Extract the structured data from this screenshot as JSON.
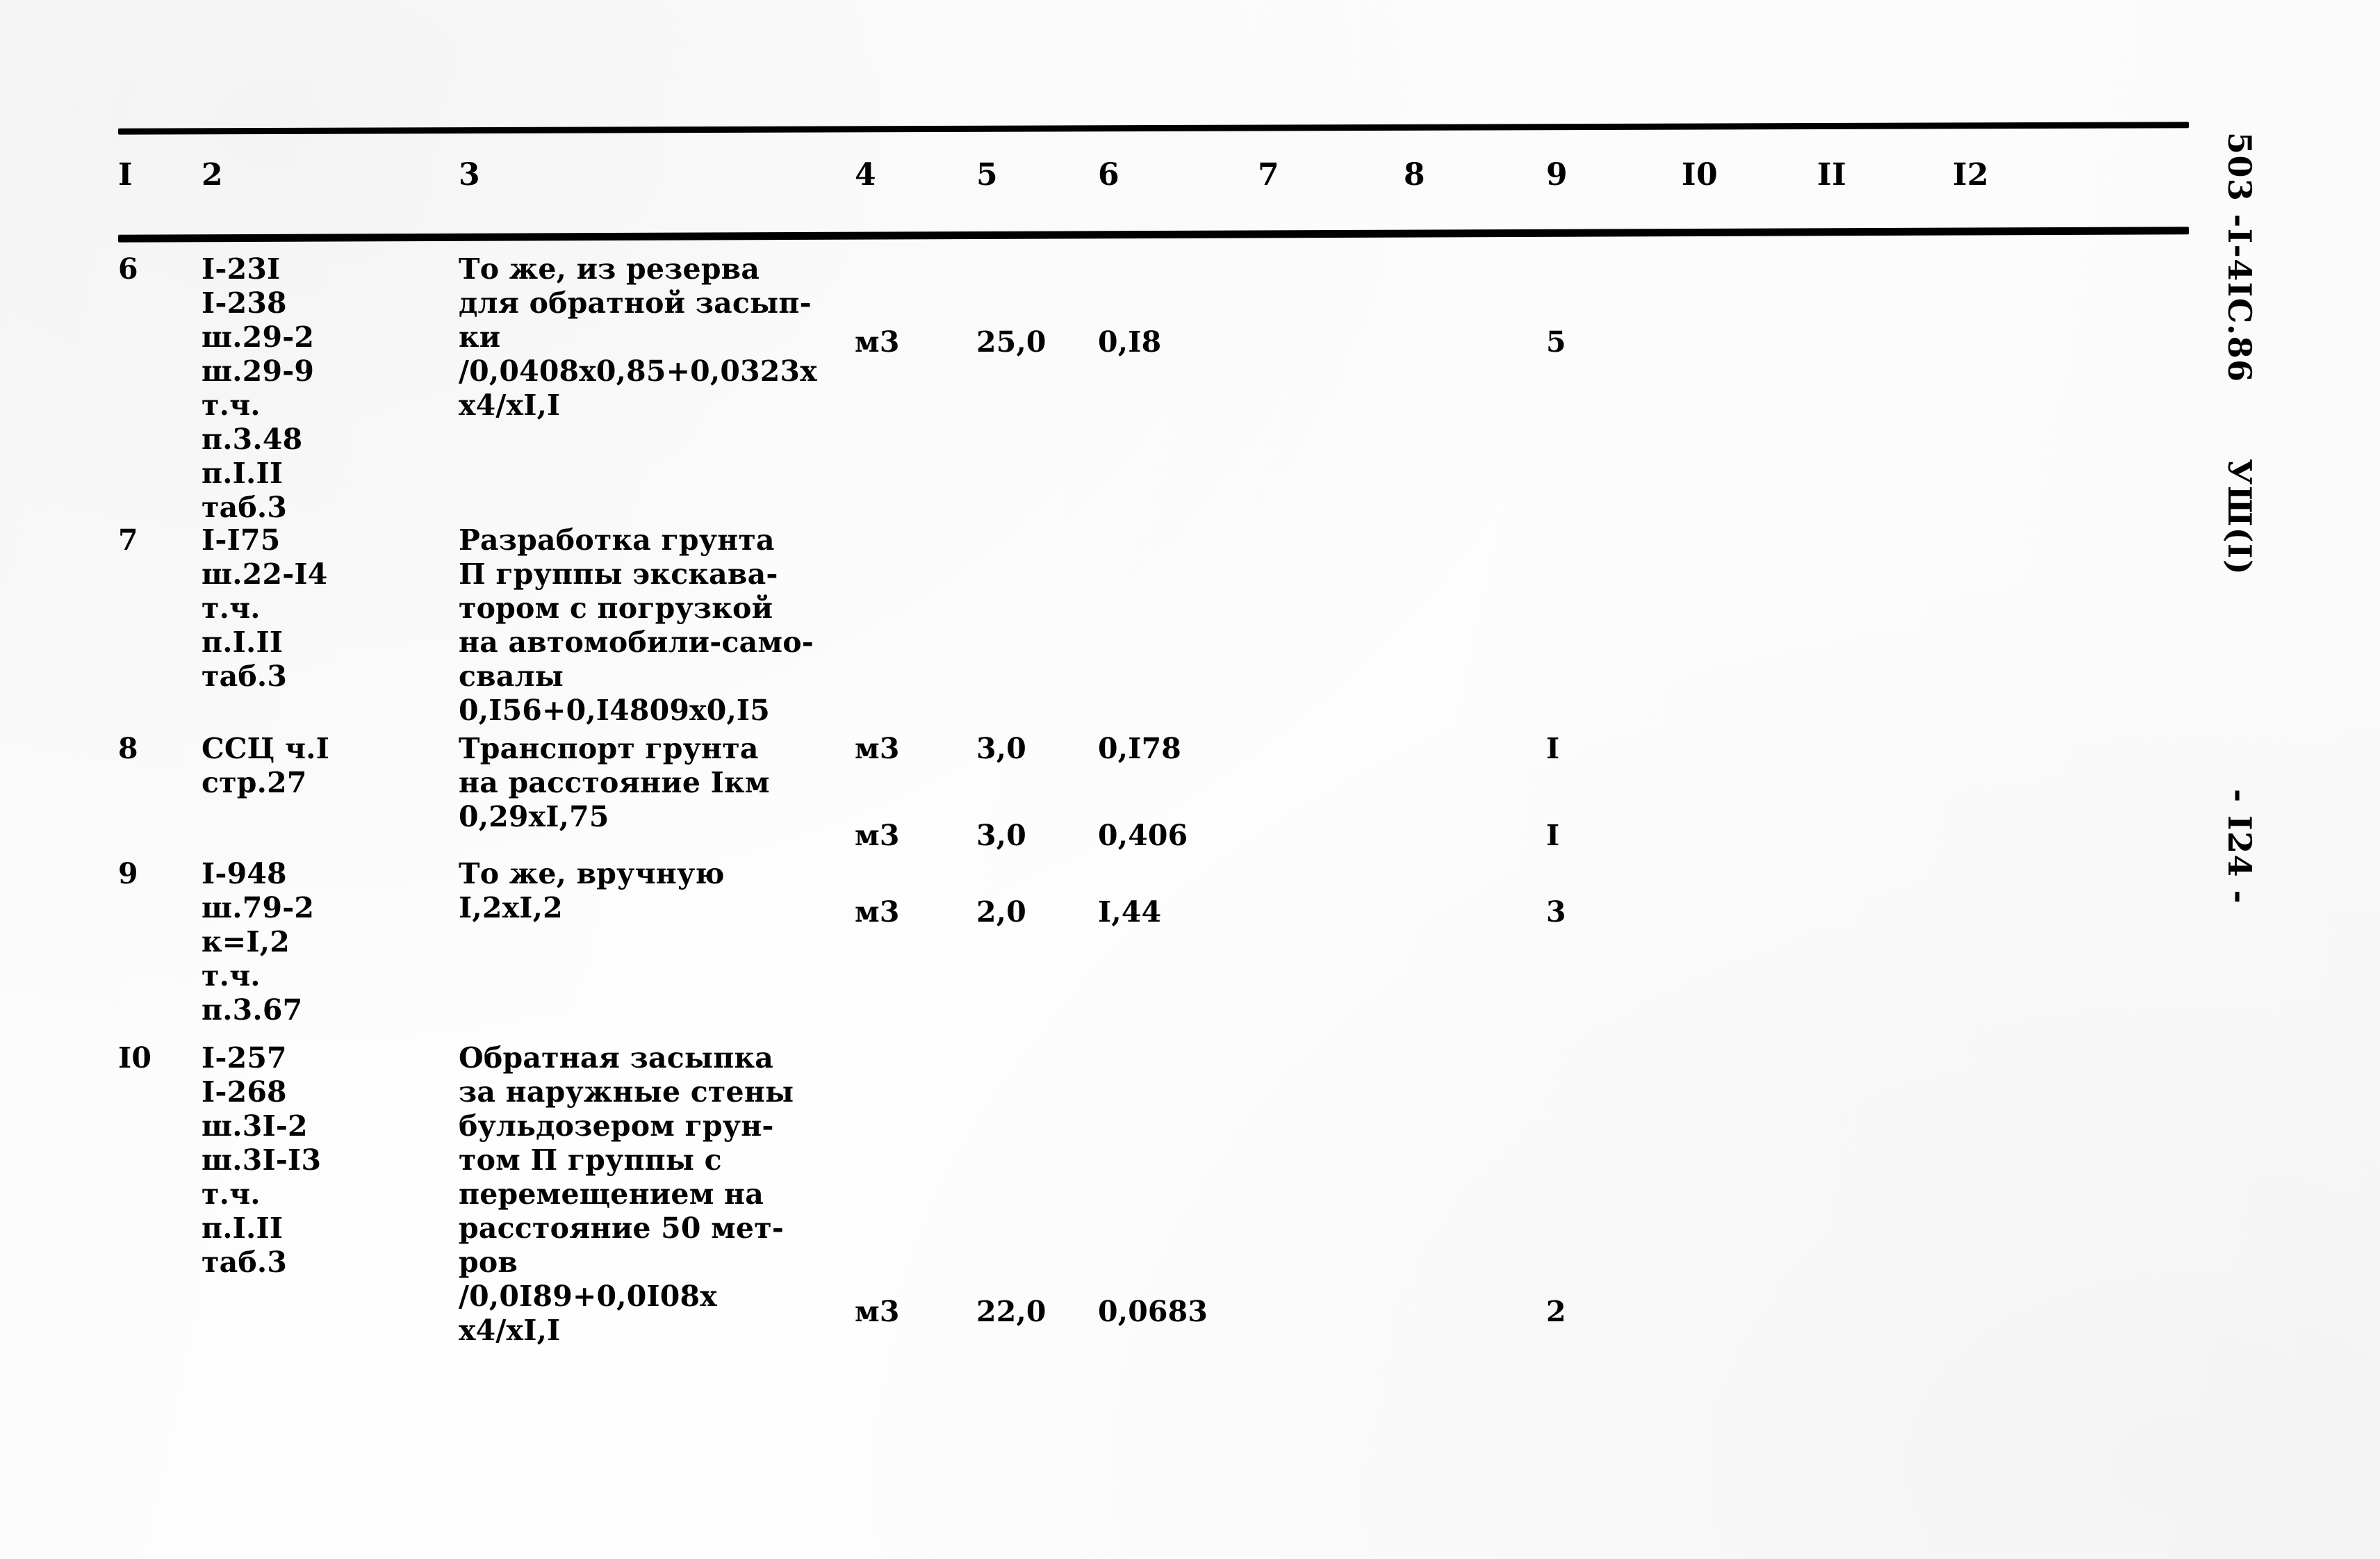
{
  "document": {
    "margin_stamps": [
      {
        "id": "document-code",
        "text": "503 -I-4IC.86"
      },
      {
        "id": "section-code",
        "text": "УШ(I)"
      },
      {
        "id": "page-number",
        "text": "- I24 -"
      }
    ]
  },
  "table": {
    "column_headers": [
      "I",
      "2",
      "3",
      "4",
      "5",
      "6",
      "7",
      "8",
      "9",
      "I0",
      "II",
      "I2"
    ],
    "rows": [
      {
        "num": "6",
        "codes": [
          "I-23I",
          "I-238",
          "ш.29-2",
          "ш.29-9",
          "т.ч.",
          "п.3.48",
          "п.I.II",
          "таб.3"
        ],
        "description": [
          "То же, из резерва",
          "для обратной засып-",
          "ки",
          "/0,0408х0,85+0,0323х",
          "х4/хI,I"
        ],
        "unit": "м3",
        "col5": "25,0",
        "col6": "0,I8",
        "col9": "5"
      },
      {
        "num": "7",
        "codes": [
          "I-I75",
          "ш.22-I4",
          "т.ч.",
          "п.I.II",
          "таб.3"
        ],
        "description": [
          "Разработка грунта",
          "П группы экскава-",
          "тором с погрузкой",
          "на автомобили-само-",
          "свалы",
          "0,I56+0,I4809х0,I5"
        ],
        "unit": "м3",
        "col5": "3,0",
        "col6": "0,I78",
        "col9": "I"
      },
      {
        "num": "8",
        "codes": [
          "ССЦ ч.I",
          "стр.27"
        ],
        "description": [
          "Транспорт грунта",
          "на расстояние Iкм",
          "0,29хI,75"
        ],
        "unit": "м3",
        "col5": "3,0",
        "col6": "0,406",
        "col9": "I"
      },
      {
        "num": "9",
        "codes": [
          "I-948",
          "ш.79-2",
          "к=I,2",
          "т.ч.",
          "п.3.67"
        ],
        "description": [
          "То же, вручную",
          "I,2хI,2"
        ],
        "unit": "м3",
        "col5": "2,0",
        "col6": "I,44",
        "col9": "3"
      },
      {
        "num": "I0",
        "codes": [
          "I-257",
          "I-268",
          "ш.3I-2",
          "ш.3I-I3",
          "т.ч.",
          "п.I.II",
          "таб.3"
        ],
        "description": [
          "Обратная засыпка",
          "за наружные стены",
          "бульдозером грун-",
          "том П группы с",
          "перемещением на",
          "расстояние 50 мет-",
          "ров",
          "/0,0I89+0,0I08х",
          "х4/хI,I"
        ],
        "unit": "м3",
        "col5": "22,0",
        "col6": "0,0683",
        "col9": "2"
      }
    ]
  },
  "layout": {
    "col_x": {
      "c1": 0,
      "c2": 120,
      "c3": 490,
      "c4": 1060,
      "c5": 1235,
      "c6": 1410,
      "c7": 1640,
      "c8": 1850,
      "c9": 2055,
      "c10": 2250,
      "c11": 2445,
      "c12": 2640
    },
    "row_tops": [
      20,
      410,
      710,
      890,
      1155
    ],
    "row_value_line": [
      105,
      300,
      125,
      55,
      365
    ],
    "desc_formula_gap": [
      0,
      0,
      0,
      0,
      0
    ]
  },
  "colors": {
    "ink": "#101010",
    "paper": "#fefefe"
  }
}
